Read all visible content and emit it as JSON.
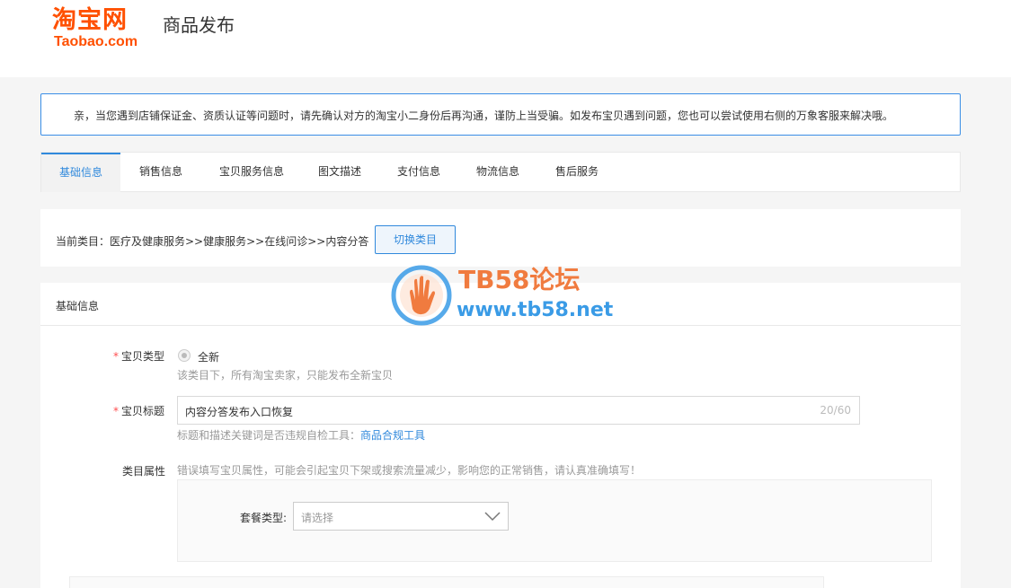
{
  "header": {
    "logo_cn": "淘宝网",
    "logo_en": "Taobao.com",
    "title": "商品发布"
  },
  "notice": {
    "text": "亲，当您遇到店铺保证金、资质认证等问题时，请先确认对方的淘宝小二身份后再沟通，谨防上当受骗。如发布宝贝遇到问题，您也可以尝试使用右侧的万象客服来解决哦。"
  },
  "tabs": [
    {
      "label": "基础信息",
      "active": true
    },
    {
      "label": "销售信息",
      "active": false
    },
    {
      "label": "宝贝服务信息",
      "active": false
    },
    {
      "label": "图文描述",
      "active": false
    },
    {
      "label": "支付信息",
      "active": false
    },
    {
      "label": "物流信息",
      "active": false
    },
    {
      "label": "售后服务",
      "active": false
    }
  ],
  "category": {
    "text": "当前类目：医疗及健康服务>>健康服务>>在线问诊>>内容分答",
    "switch_label": "切换类目"
  },
  "watermark": {
    "title": "TB58论坛",
    "url": "www.tb58.net"
  },
  "basic": {
    "section_title": "基础信息",
    "item_type_label": "宝贝类型",
    "item_type_value": "全新",
    "item_type_help": "该类目下，所有淘宝卖家，只能发布全新宝贝",
    "item_title_label": "宝贝标题",
    "item_title_value": "内容分答发布入口恢复",
    "item_title_count": "20/60",
    "item_title_help": "标题和描述关键词是否违规自检工具：",
    "item_title_help_link": "商品合规工具",
    "attr_label": "类目属性",
    "attr_help": "错误填写宝贝属性，可能会引起宝贝下架或搜索流量减少，影响您的正常销售，请认真准确填写！",
    "combo_label": "套餐类型:",
    "combo_placeholder": "请选择"
  },
  "colors": {
    "brand": "#ff5000",
    "accent": "#3089dc",
    "required": "#ff4d4f"
  }
}
